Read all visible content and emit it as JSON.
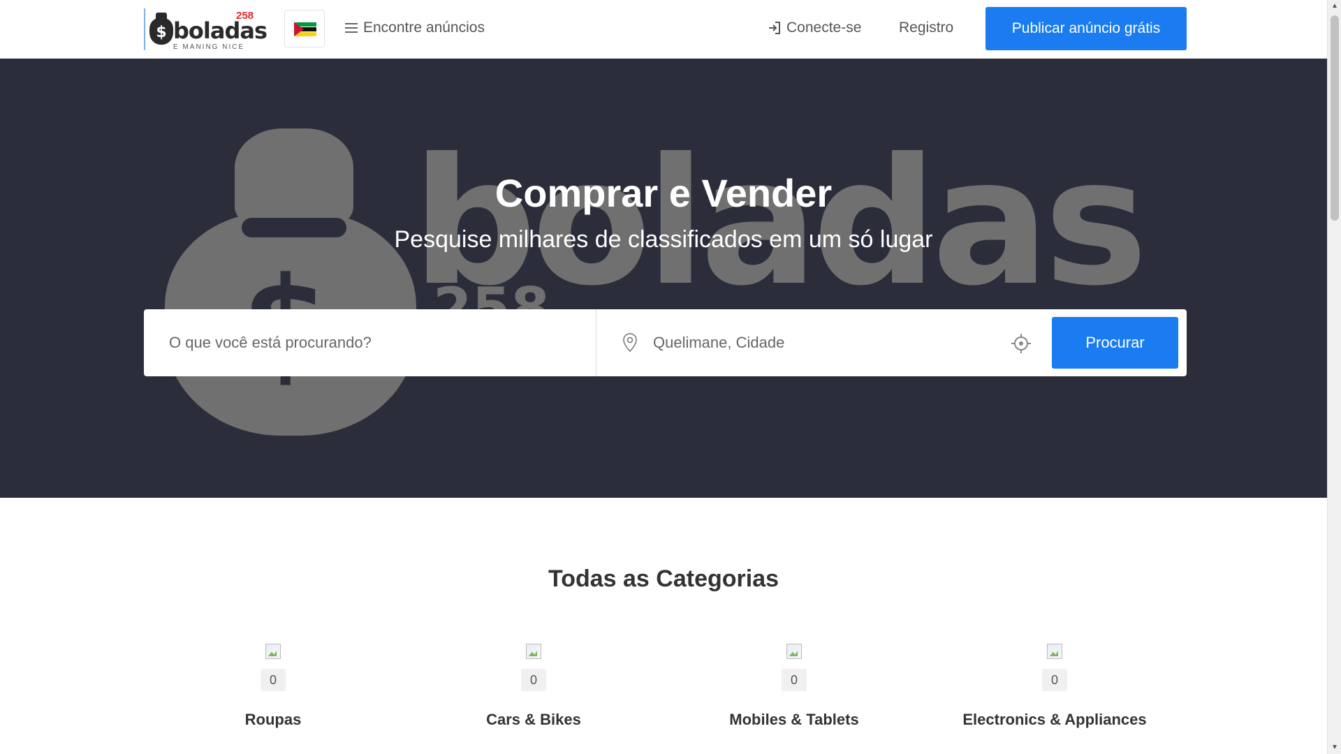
{
  "header": {
    "logo": {
      "wordmark": "boladas",
      "number": "258",
      "tagline": "E MANING NICE"
    },
    "country_flag": "mozambique-flag",
    "nav": {
      "find_ads": "Encontre anúncios",
      "login": "Conecte-se",
      "register": "Registro",
      "publish": "Publicar anúncio grátis"
    }
  },
  "hero": {
    "title": "Comprar e Vender",
    "subtitle": "Pesquise milhares de classificados em um só lugar",
    "search": {
      "keyword_placeholder": "O que você está procurando?",
      "location_placeholder": "Quelimane, Cidade",
      "button": "Procurar"
    }
  },
  "categories": {
    "title": "Todas as Categorias",
    "items": [
      {
        "label": "Roupas",
        "count": "0"
      },
      {
        "label": "Cars & Bikes",
        "count": "0"
      },
      {
        "label": "Mobiles & Tablets",
        "count": "0"
      },
      {
        "label": "Electronics & Appliances",
        "count": "0"
      }
    ]
  },
  "colors": {
    "primary": "#1a7cf0",
    "hero_bg": "#2b2e3a",
    "watermark": "#707070",
    "logo_accent": "#e8262c"
  },
  "icons": [
    "menu-icon",
    "login-icon",
    "map-pin-icon",
    "crosshair-icon",
    "image-placeholder-icon"
  ]
}
